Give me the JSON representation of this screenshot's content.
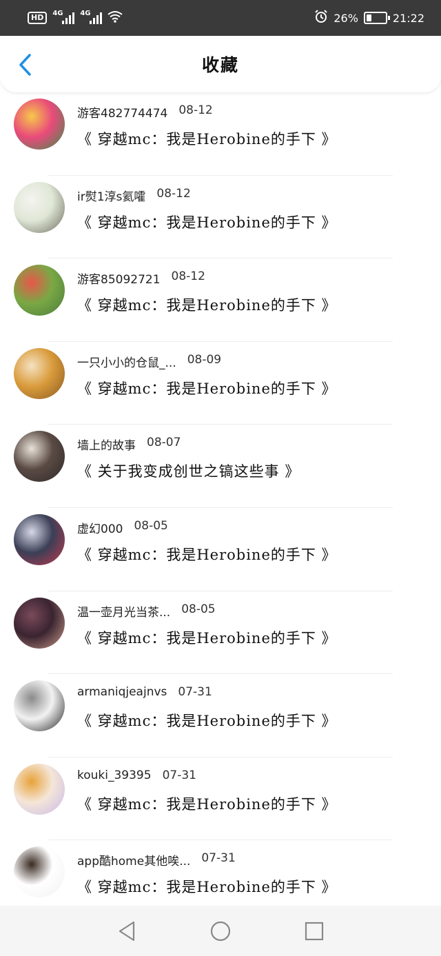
{
  "status_bar": {
    "hd_label": "HD",
    "net_1": "4G",
    "net_2": "4G",
    "battery_pct": "26%",
    "battery_level": 0.26,
    "time": "21:22"
  },
  "header": {
    "title": "收藏",
    "accent": "#1e8fe6"
  },
  "items": [
    {
      "user": "游客482774474",
      "date": "08-12",
      "title": "《 穿越mc：我是Herobine的手下 》",
      "avatar_colors": [
        "#e94a7b",
        "#f6c84a",
        "#3b8f4a"
      ]
    },
    {
      "user": "ir熨1淳s氦嚯",
      "date": "08-12",
      "title": "《 穿越mc：我是Herobine的手下 》",
      "avatar_colors": [
        "#dfe7d6",
        "#f4f4f0",
        "#6b6b5e"
      ]
    },
    {
      "user": "游客85092721",
      "date": "08-12",
      "title": "《 穿越mc：我是Herobine的手下 》",
      "avatar_colors": [
        "#7aa845",
        "#e8574a",
        "#4a7c3c"
      ]
    },
    {
      "user": "一只小小的仓鼠_...",
      "date": "08-09",
      "title": "《 穿越mc：我是Herobine的手下 》",
      "avatar_colors": [
        "#d99b3b",
        "#f5e2c2",
        "#8a5a22"
      ]
    },
    {
      "user": "墙上的故事",
      "date": "08-07",
      "title": "《 关于我变成创世之镐这些事 》",
      "avatar_colors": [
        "#5a4a44",
        "#e8e2d8",
        "#2e2a28"
      ]
    },
    {
      "user": "虚幻000",
      "date": "08-05",
      "title": "《 穿越mc：我是Herobine的手下 》",
      "avatar_colors": [
        "#3b3f56",
        "#d6d8e6",
        "#c23a4e"
      ]
    },
    {
      "user": "温一壶月光当茶...",
      "date": "08-05",
      "title": "《 穿越mc：我是Herobine的手下 》",
      "avatar_colors": [
        "#3a2430",
        "#7a4a5a",
        "#c99a8a"
      ]
    },
    {
      "user": "armaniqjeajnvs",
      "date": "07-31",
      "title": "《 穿越mc：我是Herobine的手下 》",
      "avatar_colors": [
        "#f2f2f2",
        "#8a8a8a",
        "#222222"
      ]
    },
    {
      "user": "kouki_39395",
      "date": "07-31",
      "title": "《 穿越mc：我是Herobine的手下 》",
      "avatar_colors": [
        "#f4e6d8",
        "#e8a23a",
        "#c9b8e8"
      ]
    },
    {
      "user": "app酷home其他唉...",
      "date": "07-31",
      "title": "《 穿越mc：我是Herobine的手下 》",
      "avatar_colors": [
        "#ffffff",
        "#3a2a22",
        "#f1f1f1"
      ]
    }
  ],
  "nav": {
    "back": "back-icon",
    "home": "home-icon",
    "recents": "recents-icon"
  }
}
